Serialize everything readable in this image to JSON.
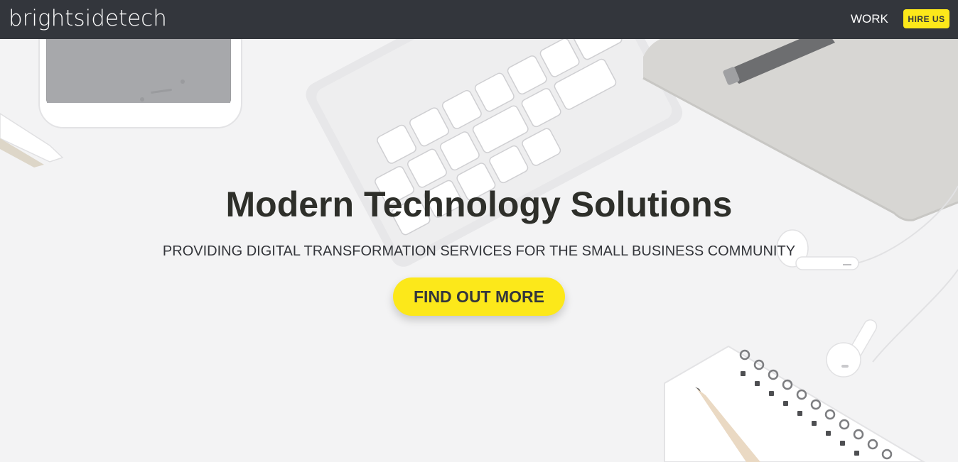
{
  "navbar": {
    "logo_text": "brightsidetech",
    "work_label": "WORK",
    "hire_label": "HIRE US"
  },
  "hero": {
    "title": "Modern Technology Solutions",
    "subtitle": "PROVIDING DIGITAL TRANSFORMATION SERVICES FOR THE SMALL BUSINESS COMMUNITY",
    "cta_label": "FIND OUT MORE"
  },
  "colors": {
    "navbar_bg": "#33363c",
    "accent_yellow": "#fce81a",
    "hero_bg": "#f3f3f4",
    "title_text": "#2e2f2a"
  }
}
